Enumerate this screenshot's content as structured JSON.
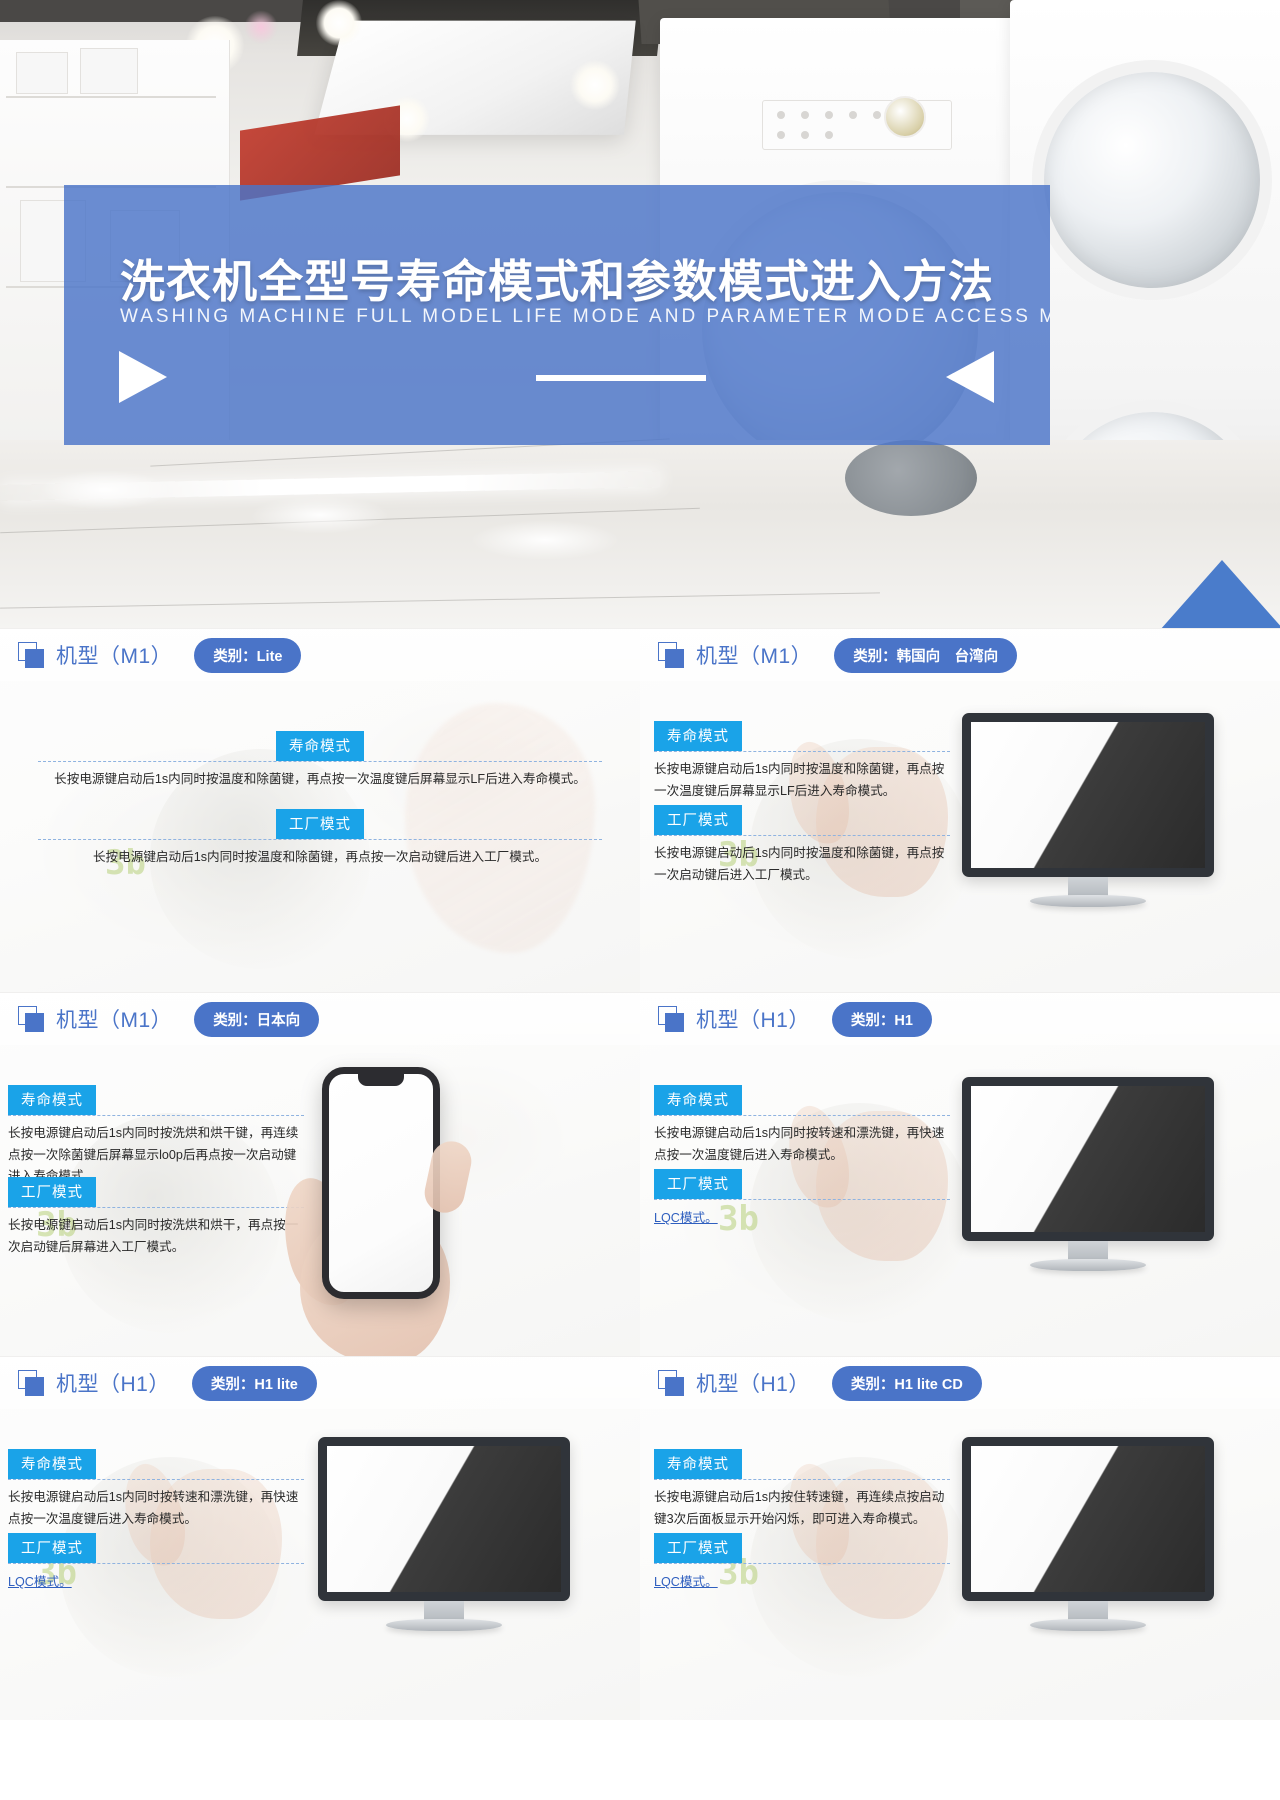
{
  "hero": {
    "title_cn": "洗衣机全型号寿命模式和参数模式进入方法",
    "title_en": "WASHING MACHINE FULL MODEL LIFE MODE AND PARAMETER MODE ACCESS METHOD",
    "icons": {
      "play_right": "play-right-triangle-icon",
      "play_left": "play-left-triangle-icon"
    },
    "accent_color": "#4a74c8"
  },
  "labels": {
    "life_mode_tag": "寿命模式",
    "factory_mode_tag": "工厂模式",
    "lqc_link": "LQC模式。",
    "category_prefix": "类别："
  },
  "colors": {
    "brand_blue": "#4a74c8",
    "tag_cyan": "#1aa3e8",
    "link_blue": "#2f5fbf"
  },
  "cards": [
    {
      "model": "机型（M1）",
      "category": "类别：Lite",
      "layout": "centered",
      "device": "none",
      "blocks": [
        {
          "tag": "寿命模式",
          "text": "长按电源键启动后1s内同时按温度和除菌键，再点按一次温度键后屏幕显示LF后进入寿命模式。"
        },
        {
          "tag": "工厂模式",
          "text": "长按电源键启动后1s内同时按温度和除菌键，再点按一次启动键后进入工厂模式。"
        }
      ]
    },
    {
      "model": "机型（M1）",
      "category": "类别：韩国向　台湾向",
      "layout": "left",
      "device": "monitor",
      "blocks": [
        {
          "tag": "寿命模式",
          "text": "长按电源键启动后1s内同时按温度和除菌键，再点按一次温度键后屏幕显示LF后进入寿命模式。"
        },
        {
          "tag": "工厂模式",
          "text": "长按电源键启动后1s内同时按温度和除菌键，再点按一次启动键后进入工厂模式。"
        }
      ]
    },
    {
      "model": "机型（M1）",
      "category": "类别：日本向",
      "layout": "left",
      "device": "phone",
      "blocks": [
        {
          "tag": "寿命模式",
          "text": "长按电源键启动后1s内同时按洗烘和烘干键，再连续点按一次除菌键后屏幕显示lo0p后再点按一次启动键进入寿命模式。"
        },
        {
          "tag": "工厂模式",
          "text": "长按电源键启动后1s内同时按洗烘和烘干，再点按一次启动键后屏幕进入工厂模式。"
        }
      ]
    },
    {
      "model": "机型（H1）",
      "category": "类别：H1",
      "layout": "left",
      "device": "monitor",
      "blocks": [
        {
          "tag": "寿命模式",
          "text": "长按电源键启动后1s内同时按转速和漂洗键，再快速点按一次温度键后进入寿命模式。"
        },
        {
          "tag": "工厂模式",
          "link": "LQC模式。"
        }
      ]
    },
    {
      "model": "机型（H1）",
      "category": "类别：H1 lite",
      "layout": "left",
      "device": "monitor",
      "blocks": [
        {
          "tag": "寿命模式",
          "text": "长按电源键启动后1s内同时按转速和漂洗键，再快速点按一次温度键后进入寿命模式。"
        },
        {
          "tag": "工厂模式",
          "link": "LQC模式。"
        }
      ]
    },
    {
      "model": "机型（H1）",
      "category": "类别：H1 lite CD",
      "layout": "left",
      "device": "monitor",
      "blocks": [
        {
          "tag": "寿命模式",
          "text": "长按电源键启动后1s内按住转速键，再连续点按启动键3次后面板显示开始闪烁，即可进入寿命模式。"
        },
        {
          "tag": "工厂模式",
          "link": "LQC模式。"
        }
      ]
    }
  ]
}
